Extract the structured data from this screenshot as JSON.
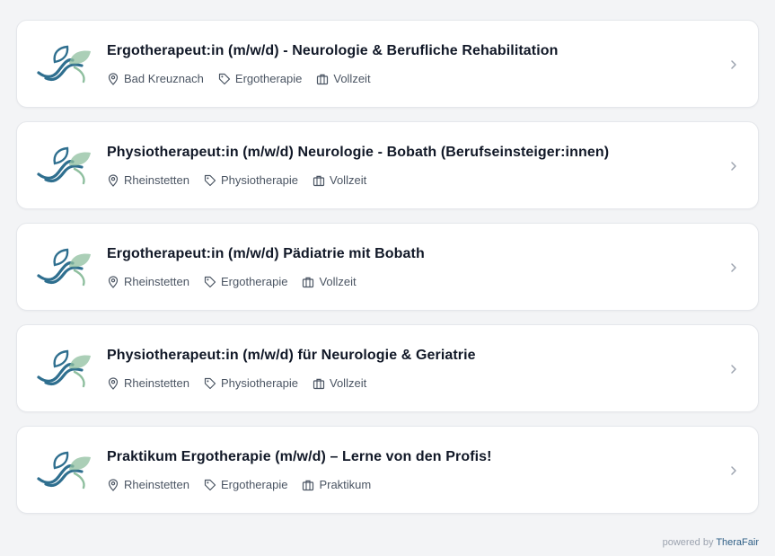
{
  "jobs": [
    {
      "title": "Ergotherapeut:in (m/w/d) - Neurologie & Berufliche Rehabilitation",
      "location": "Bad Kreuznach",
      "category": "Ergotherapie",
      "employment": "Vollzeit"
    },
    {
      "title": "Physiotherapeut:in (m/w/d) Neurologie - Bobath (Berufseinsteiger:innen)",
      "location": "Rheinstetten",
      "category": "Physiotherapie",
      "employment": "Vollzeit"
    },
    {
      "title": "Ergotherapeut:in (m/w/d) Pädiatrie mit Bobath",
      "location": "Rheinstetten",
      "category": "Ergotherapie",
      "employment": "Vollzeit"
    },
    {
      "title": "Physiotherapeut:in (m/w/d) für Neurologie & Geriatrie",
      "location": "Rheinstetten",
      "category": "Physiotherapie",
      "employment": "Vollzeit"
    },
    {
      "title": "Praktikum Ergotherapie (m/w/d) – Lerne von den Profis!",
      "location": "Rheinstetten",
      "category": "Ergotherapie",
      "employment": "Praktikum"
    }
  ],
  "footer": {
    "powered_prefix": "powered by",
    "brand": "TheraFair"
  },
  "icons": {
    "logo": "leaf-wave-logo-icon",
    "location": "map-pin-icon",
    "category": "tag-icon",
    "employment": "briefcase-icon",
    "open": "chevron-right-icon"
  },
  "colors": {
    "logo_blue": "#2f6f8f",
    "logo_green": "#8fbf9f",
    "meta_text": "#4b5563",
    "brand": "#2f5f86"
  }
}
